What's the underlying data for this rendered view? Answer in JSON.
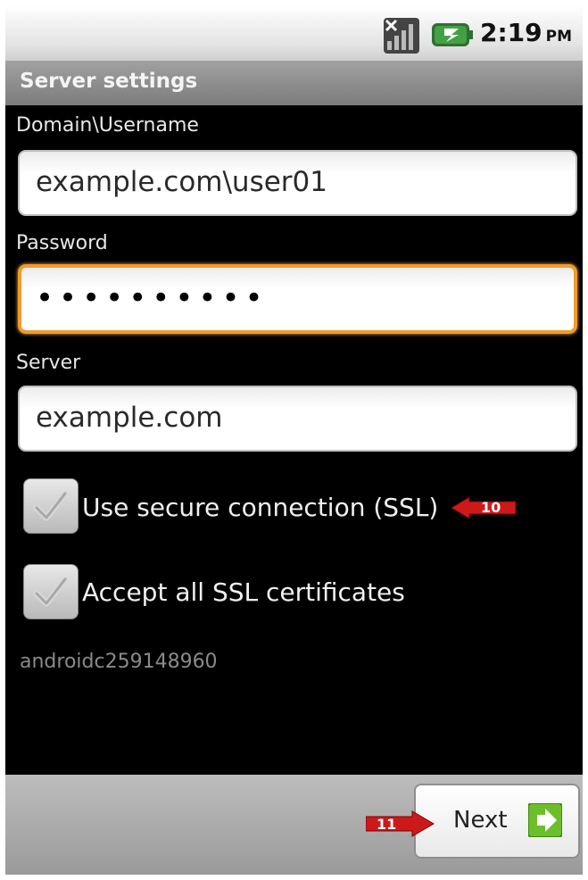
{
  "status_bar": {
    "time": "2:19",
    "ampm": "PM",
    "icons": [
      "signal-no-sim-icon",
      "battery-charging-icon"
    ]
  },
  "header": {
    "title": "Server settings"
  },
  "form": {
    "domain_label": "Domain\\Username",
    "domain_value": "example.com\\user01",
    "password_label": "Password",
    "password_mask": "••••••••••",
    "server_label": "Server",
    "server_value": "example.com",
    "ssl_label": "Use secure connection (SSL)",
    "ssl_checked": true,
    "certs_label": "Accept all SSL certificates",
    "certs_checked": true,
    "account_id": "androidc259148960"
  },
  "annotations": {
    "step_10": "10",
    "step_11": "11",
    "color": "#cc1a1a"
  },
  "footer": {
    "next_label": "Next"
  },
  "colors": {
    "focus": "#f29a2c",
    "next_icon": "#6cbf2a"
  }
}
